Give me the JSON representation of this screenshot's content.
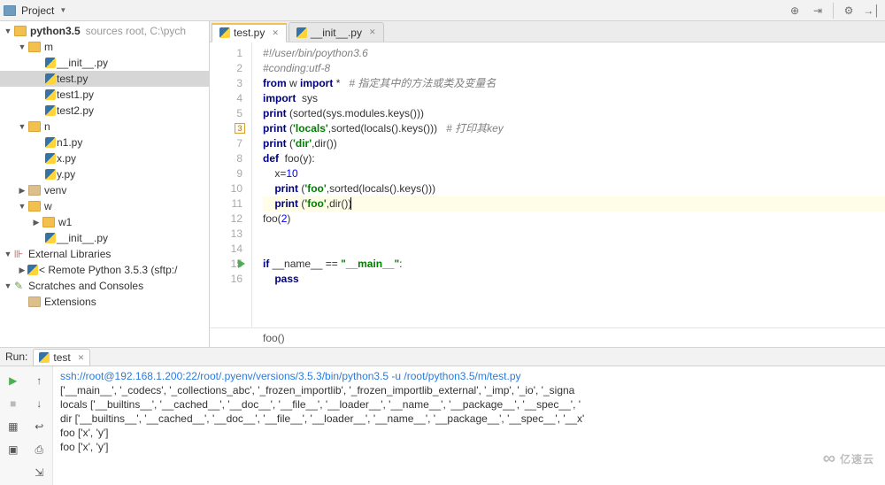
{
  "project_header": {
    "title": "Project"
  },
  "tree": {
    "root": {
      "name": "python3.5",
      "hint": "sources root,  C:\\pych"
    },
    "m": "m",
    "m_files": [
      "__init__.py",
      "test.py",
      "test1.py",
      "test2.py"
    ],
    "n": "n",
    "n_files": [
      "n1.py",
      "x.py",
      "y.py"
    ],
    "venv": "venv",
    "w": "w",
    "w_dirs": [
      "w1"
    ],
    "w_files": [
      "__init__.py"
    ],
    "ext_lib": "External Libraries",
    "remote": "< Remote Python 3.5.3 (sftp:/",
    "scratch": "Scratches and Consoles",
    "ext_cut": "Extensions"
  },
  "tabs": [
    {
      "label": "test.py",
      "active": true
    },
    {
      "label": "__init__.py",
      "active": false
    }
  ],
  "code": {
    "l1": "#!/user/bin/poython3.6",
    "l2": "#conding:utf-8",
    "l3a": "from",
    "l3b": " w ",
    "l3c": "import",
    "l3d": " *   ",
    "l3e": "# 指定其中的方法或类及变量名",
    "l4a": "import",
    "l4b": "  sys",
    "l5a": "print",
    "l5b": " (sorted(sys.modules.keys()))",
    "l6a": "print",
    "l6b": " (",
    "l6c": "'locals'",
    "l6d": ",sorted(locals().keys()))   ",
    "l6e": "# 打印其key",
    "l7a": "print",
    "l7b": " (",
    "l7c": "'dir'",
    "l7d": ",dir())",
    "l8a": "def",
    "l8b": "  foo(y):",
    "l9a": "    x=",
    "l9b": "10",
    "l10a": "    ",
    "l10b": "print",
    "l10c": " (",
    "l10d": "'foo'",
    "l10e": ",sorted(locals().keys()))",
    "l11a": "    ",
    "l11b": "print",
    "l11c": " (",
    "l11d": "'foo'",
    "l11e": ",dir())",
    "l12": "foo(",
    "l12b": "2",
    "l12c": ")",
    "l15a": "if",
    "l15b": " __name__ == ",
    "l15c": "\"__main__\"",
    "l15d": ":",
    "l16a": "    ",
    "l16b": "pass"
  },
  "breadcrumb": "foo()",
  "run": {
    "label": "Run:",
    "tab": "test",
    "cmd": "ssh://root@192.168.1.200:22/root/.pyenv/versions/3.5.3/bin/python3.5 -u /root/python3.5/m/test.py",
    "out1": "['__main__', '_codecs', '_collections_abc', '_frozen_importlib', '_frozen_importlib_external', '_imp', '_io', '_signa",
    "out2": "locals ['__builtins__', '__cached__', '__doc__', '__file__', '__loader__', '__name__', '__package__', '__spec__', '",
    "out3": "dir ['__builtins__', '__cached__', '__doc__', '__file__', '__loader__', '__name__', '__package__', '__spec__', '__x'",
    "out4": "foo ['x', 'y']",
    "out5": "foo ['x', 'y']"
  },
  "watermark": "亿速云"
}
